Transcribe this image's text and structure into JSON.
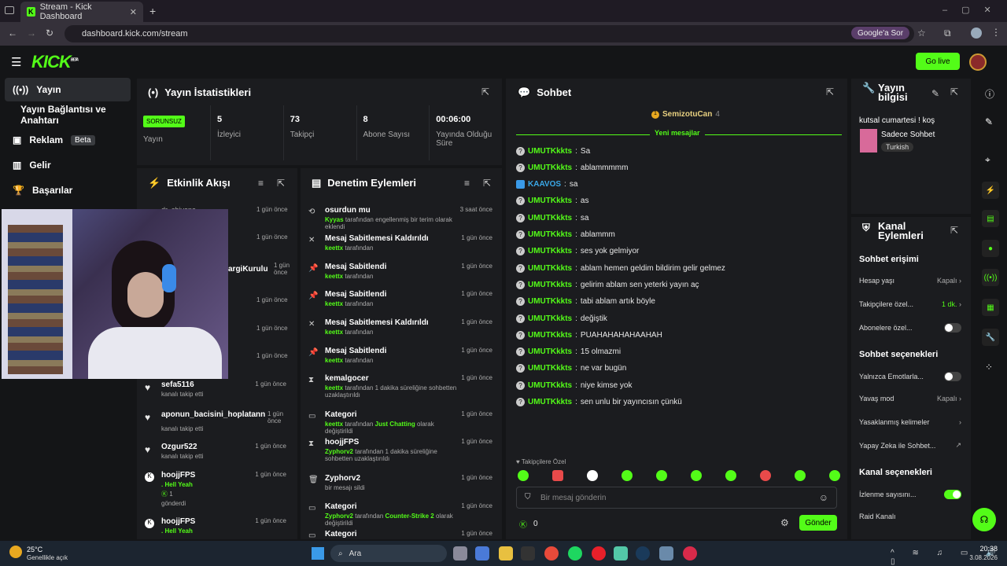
{
  "browser": {
    "tab_title": "Stream - Kick Dashboard",
    "url": "dashboard.kick.com/stream",
    "google_btn": "Google'a Sor"
  },
  "header": {
    "logo": "KICK",
    "logo_beta": "BETA",
    "go_live": "Go live"
  },
  "sidebar": {
    "items": [
      {
        "label": "Yayın"
      },
      {
        "label": "Yayın Bağlantısı ve Anahtarı"
      },
      {
        "label": "Reklam",
        "badge": "Beta"
      },
      {
        "label": "Gelir"
      },
      {
        "label": "Başarılar"
      }
    ]
  },
  "stats": {
    "title": "Yayın İstatistikleri",
    "status": "SORUNSUZ",
    "status_label": "Yayın",
    "cells": [
      {
        "value": "5",
        "label": "İzleyici"
      },
      {
        "value": "73",
        "label": "Takipçi"
      },
      {
        "value": "8",
        "label": "Abone Sayısı"
      },
      {
        "value": "00:06:00",
        "label": "Yayında Olduğu Süre"
      }
    ]
  },
  "activity": {
    "title": "Etkinlik Akışı",
    "rows": [
      {
        "name": "sefa5116",
        "sub": "kanalı takip etti",
        "time": "1 gün önce"
      },
      {
        "name": "aponun_bacisini_hoplatann",
        "sub": "kanalı takip etti",
        "time": "1 gün önce"
      },
      {
        "name": "Ozgur522",
        "sub": "kanalı takip etti",
        "time": "1 gün önce"
      },
      {
        "name": "hoojjFPS",
        "sub": ". Hell Yeah",
        "extra": "1",
        "extra2": "gönderdi",
        "time": "1 gün önce"
      },
      {
        "name": "hoojjFPS",
        "sub": ". Hell Yeah",
        "time": "1 gün önce"
      }
    ],
    "partial": [
      "1 gün önce",
      "1 gün önce",
      "1 gün önce",
      "1 gün önce",
      "1 gün önce",
      "1 gün önce"
    ],
    "partial_name": "argiKurulu",
    "partial_top": "dr_sbivana"
  },
  "moderation": {
    "title": "Denetim Eylemleri",
    "rows": [
      {
        "title": "osurdun mu",
        "user": "Kyyas",
        "rest": "tarafından engellenmiş bir terim olarak eklendi",
        "time": "3 saat önce"
      },
      {
        "title": "Mesaj Sabitlemesi Kaldırıldı",
        "user": "keettx",
        "rest": "tarafından",
        "time": "1 gün önce"
      },
      {
        "title": "Mesaj Sabitlendi",
        "user": "keettx",
        "rest": "tarafından",
        "time": "1 gün önce"
      },
      {
        "title": "Mesaj Sabitlendi",
        "user": "keettx",
        "rest": "tarafından",
        "time": "1 gün önce"
      },
      {
        "title": "Mesaj Sabitlemesi Kaldırıldı",
        "user": "keettx",
        "rest": "tarafından",
        "time": "1 gün önce"
      },
      {
        "title": "Mesaj Sabitlendi",
        "user": "keettx",
        "rest": "tarafından",
        "time": "1 gün önce"
      },
      {
        "title": "kemalgocer",
        "user": "keettx",
        "rest": "tarafından 1 dakika süreliğine sohbetten uzaklaştırıldı",
        "time": "1 gün önce"
      },
      {
        "title": "Kategori",
        "user": "keettx",
        "rest": "tarafından",
        "hl": "Just Chatting",
        "rest2": "olarak değiştirildi",
        "time": "1 gün önce"
      },
      {
        "title": "hoojjFPS",
        "user": "Zyphorv2",
        "rest": "tarafından 1 dakika süreliğine sohbetten uzaklaştırıldı",
        "time": "1 gün önce"
      },
      {
        "title": "Zyphorv2",
        "user": "",
        "rest": "bir mesajı sildi",
        "time": "1 gün önce"
      },
      {
        "title": "Kategori",
        "user": "Zyphorv2",
        "rest": "tarafından",
        "hl": "Counter-Strike 2",
        "rest2": "olarak değiştirildi",
        "time": "1 gün önce"
      },
      {
        "title": "Kategori",
        "user": "",
        "rest": "",
        "time": "1 gün önce"
      }
    ]
  },
  "chat": {
    "title": "Sohbet",
    "pinned_user": "SemizotuCan",
    "pinned_count": "4",
    "new_messages": "Yeni mesajlar",
    "messages": [
      {
        "user": "UMUTKkkts",
        "text": "Sa"
      },
      {
        "user": "UMUTKkkts",
        "text": "ablammmmm"
      },
      {
        "user": "KAAVOS",
        "text": "sa"
      },
      {
        "user": "UMUTKkkts",
        "text": "as"
      },
      {
        "user": "UMUTKkkts",
        "text": "sa"
      },
      {
        "user": "UMUTKkkts",
        "text": "ablammm"
      },
      {
        "user": "UMUTKkkts",
        "text": "ses yok gelmiyor"
      },
      {
        "user": "UMUTKkkts",
        "text": "ablam hemen geldim bildirim gelir gelmez"
      },
      {
        "user": "UMUTKkkts",
        "text": "gelirim ablam sen yeterki yayın aç"
      },
      {
        "user": "UMUTKkkts",
        "text": "tabi ablam artık böyle"
      },
      {
        "user": "UMUTKkkts",
        "text": "değiştik"
      },
      {
        "user": "UMUTKkkts",
        "text": "PUAHAHAHAHAAHAH"
      },
      {
        "user": "UMUTKkkts",
        "text": "15 olmazmi"
      },
      {
        "user": "UMUTKkkts",
        "text": "ne var bugün"
      },
      {
        "user": "UMUTKkkts",
        "text": "niye kimse yok"
      },
      {
        "user": "UMUTKkkts",
        "text": "sen unlu bir yayıncısın çünkü"
      }
    ],
    "emote_label": "Takipçilere Özel",
    "placeholder": "Bir mesaj gönderin",
    "points": "0",
    "send": "Gönder"
  },
  "stream_info": {
    "title": "Yayın bilgisi",
    "stream_title": "kutsal cumartesi ! koş",
    "category": "Sadece Sohbet",
    "tag": "Turkish"
  },
  "channel_actions": {
    "title": "Kanal Eylemleri",
    "chat_access": "Sohbet erişimi",
    "rows1": [
      {
        "label": "Hesap yaşı",
        "value": "Kapalı"
      },
      {
        "label": "Takipçilere özel...",
        "value": "1 dk."
      },
      {
        "label": "Abonelere özel...",
        "value": ""
      }
    ],
    "chat_options": "Sohbet seçenekleri",
    "rows2": [
      {
        "label": "Yalnızca Emotlarla...",
        "value": ""
      },
      {
        "label": "Yavaş mod",
        "value": "Kapalı"
      },
      {
        "label": "Yasaklanmış kelimeler",
        "value": ""
      },
      {
        "label": "Yapay Zeka ile Sohbet...",
        "value": ""
      }
    ],
    "channel_options": "Kanal seçenekleri",
    "rows3": [
      {
        "label": "İzlenme sayısını...",
        "value": ""
      },
      {
        "label": "Raid Kanalı",
        "value": ""
      }
    ]
  },
  "taskbar": {
    "weather_temp": "25°C",
    "weather_desc": "Genellikle açık",
    "search": "Ara",
    "time": "20:38",
    "date": "3.08.2026"
  },
  "colors": {
    "accent": "#53fc18",
    "bg": "#141517",
    "panel": "#1b1c1f"
  }
}
